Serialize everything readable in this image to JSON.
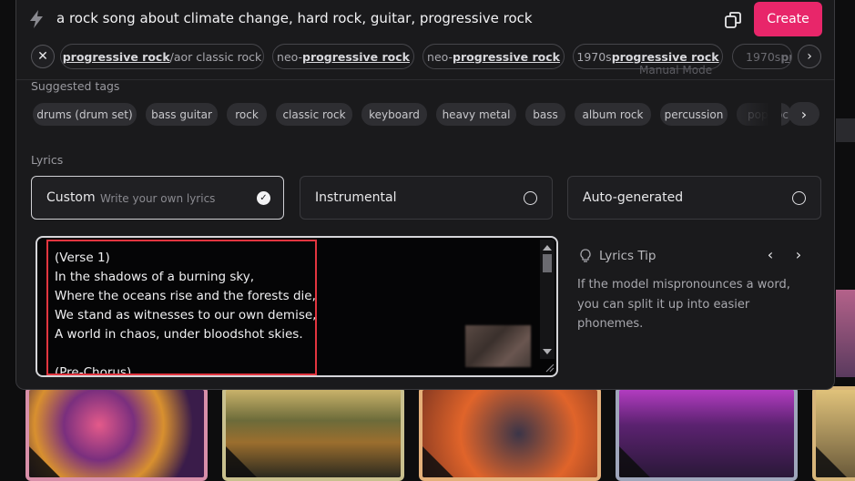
{
  "prompt": {
    "text": "a rock song about climate change, hard rock, guitar, progressive rock",
    "create_label": "Create"
  },
  "style_chips": [
    {
      "bold": "progressive rock",
      "rest": "/aor classic rock",
      "prefix": ""
    },
    {
      "prefix": "neo-",
      "bold": "progressive rock",
      "rest": ""
    },
    {
      "prefix": "neo-",
      "bold": "progressive rock",
      "rest": ""
    },
    {
      "prefix": "1970s ",
      "bold": "progressive rock",
      "rest": ""
    },
    {
      "prefix": "1970s ",
      "bold": "pro",
      "rest": ""
    }
  ],
  "ghost": {
    "manual_mode": "Manual Mode"
  },
  "suggested_tags": {
    "label": "Suggested tags",
    "items": [
      "drums (drum set)",
      "bass guitar",
      "rock",
      "classic rock",
      "keyboard",
      "heavy metal",
      "bass",
      "album rock",
      "percussion",
      "pop rock"
    ]
  },
  "lyrics": {
    "label": "Lyrics",
    "options": [
      {
        "title": "Custom",
        "subtitle": "Write your own lyrics"
      },
      {
        "title": "Instrumental"
      },
      {
        "title": "Auto-generated"
      }
    ],
    "selected": "Custom",
    "text": "(Verse 1)\nIn the shadows of a burning sky,\nWhere the oceans rise and the forests die,\nWe stand as witnesses to our own demise,\nA world in chaos, under bloodshot skies.\n\n(Pre-Chorus)"
  },
  "tip": {
    "title": "Lyrics Tip",
    "body": "If the model mispronounces a word, you can split it up into easier phonemes."
  },
  "colors": {
    "accent": "#e8266a",
    "highlight_frame": "#e2353f"
  }
}
